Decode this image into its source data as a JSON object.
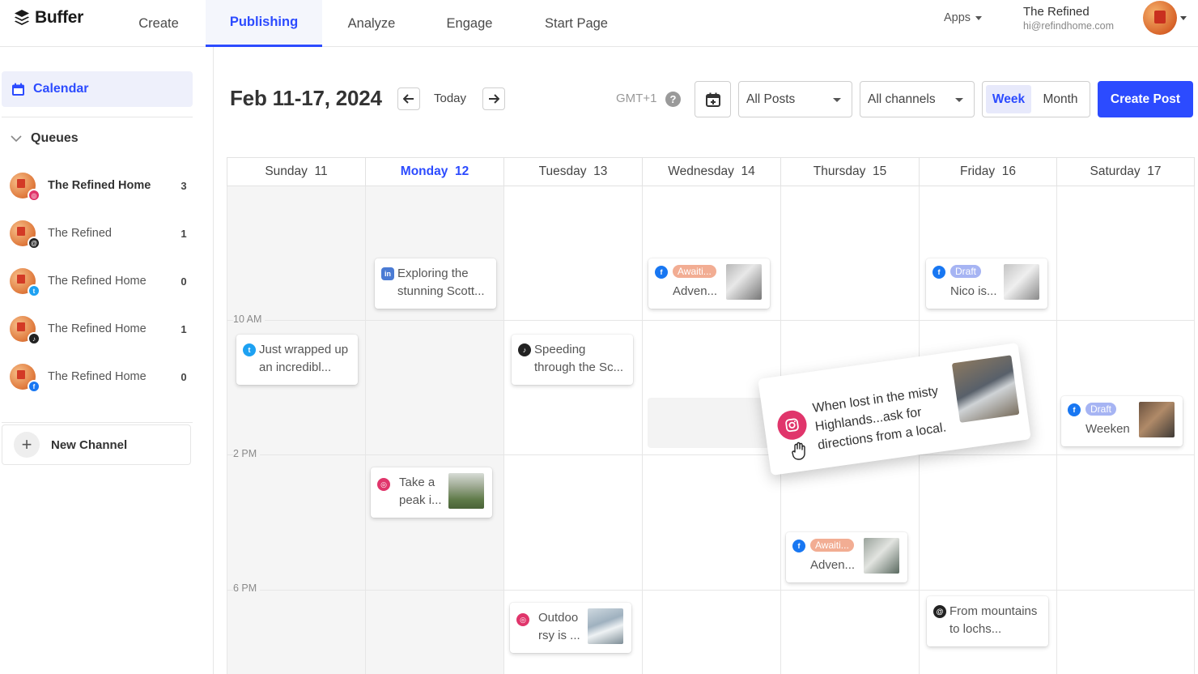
{
  "brand": {
    "name": "Buffer",
    "accent": "#2c4bff"
  },
  "nav": {
    "tabs": [
      {
        "label": "Create"
      },
      {
        "label": "Publishing"
      },
      {
        "label": "Analyze"
      },
      {
        "label": "Engage"
      },
      {
        "label": "Start Page"
      }
    ],
    "apps_label": "Apps",
    "account": {
      "name": "The Refined",
      "email": "hi@refindhome.com"
    }
  },
  "sidebar": {
    "calendar_label": "Calendar",
    "queues_label": "Queues",
    "channels": [
      {
        "name": "The Refined Home",
        "count": "3",
        "network": "instagram-icon"
      },
      {
        "name": "The Refined",
        "count": "1",
        "network": "threads-icon"
      },
      {
        "name": "The Refined Home",
        "count": "0",
        "network": "twitter-icon"
      },
      {
        "name": "The Refined Home",
        "count": "1",
        "network": "tiktok-icon"
      },
      {
        "name": "The Refined Home",
        "count": "0",
        "network": "facebook-icon"
      }
    ],
    "new_channel_label": "New Channel"
  },
  "toolbar": {
    "date_range": "Feb 11-17, 2024",
    "today_label": "Today",
    "timezone": "GMT+1",
    "help": "?",
    "post_filter": "All Posts",
    "channel_filter": "All channels",
    "view_week": "Week",
    "view_month": "Month",
    "create_post": "Create Post"
  },
  "calendar": {
    "days": [
      {
        "name": "Sunday",
        "num": "11"
      },
      {
        "name": "Monday",
        "num": "12"
      },
      {
        "name": "Tuesday",
        "num": "13"
      },
      {
        "name": "Wednesday",
        "num": "14"
      },
      {
        "name": "Thursday",
        "num": "15"
      },
      {
        "name": "Friday",
        "num": "16"
      },
      {
        "name": "Saturday",
        "num": "17"
      }
    ],
    "time_labels": [
      "10 AM",
      "2 PM",
      "6 PM"
    ],
    "posts": {
      "mon_exploring": {
        "text": "Exploring the stunning Scott..."
      },
      "wed_adven": {
        "status": "Awaiti...",
        "text": "Adven..."
      },
      "fri_nico": {
        "status": "Draft",
        "text": "Nico is..."
      },
      "sun_wrapped": {
        "text": "Just wrapped up an incredibl..."
      },
      "tue_speeding": {
        "text": "Speeding through the Sc..."
      },
      "sat_weeken": {
        "status": "Draft",
        "text": "Weeken"
      },
      "mon_peak": {
        "text": "Take a peak i..."
      },
      "thu_adven": {
        "status": "Awaiti...",
        "text": "Adven..."
      },
      "tue_outdoor": {
        "text": "Outdoo rsy is ..."
      },
      "fri_mountains": {
        "text": "From mountains to lochs..."
      },
      "dragging": {
        "text": "When lost in the misty Highlands...ask for directions from a local."
      }
    }
  },
  "colors": {
    "facebook": "#1877f2",
    "instagram": "#e0356b",
    "twitter": "#1da1f2",
    "tiktok": "#222222",
    "threads": "#222222",
    "linkedin": "#4a7bd4",
    "awaiting": "#f2ad93",
    "draft": "#a6b4f3"
  }
}
